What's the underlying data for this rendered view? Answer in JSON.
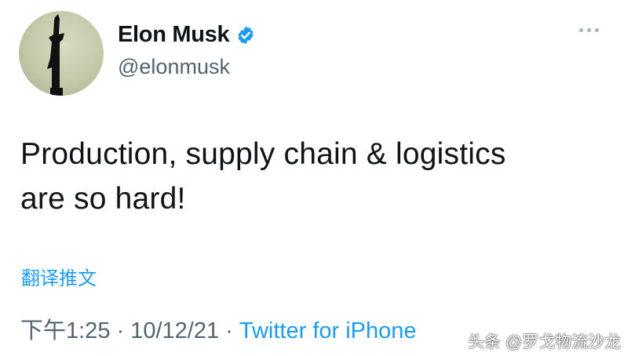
{
  "author": {
    "display_name": "Elon Musk",
    "handle": "@elonmusk",
    "verified": true
  },
  "tweet": {
    "text_lines": [
      "Production, supply chain & logistics",
      "are so hard!"
    ],
    "translate_label": "翻译推文",
    "timestamp": "下午1:25 · 10/12/21 · ",
    "source": "Twitter for iPhone"
  },
  "icons": {
    "verified": "verified-badge-icon",
    "more": "more-options-icon"
  },
  "watermark": "头条 @罗戈物流沙龙",
  "colors": {
    "link": "#1d9bf0",
    "secondary_text": "#536471",
    "primary_text": "#0f1419"
  }
}
